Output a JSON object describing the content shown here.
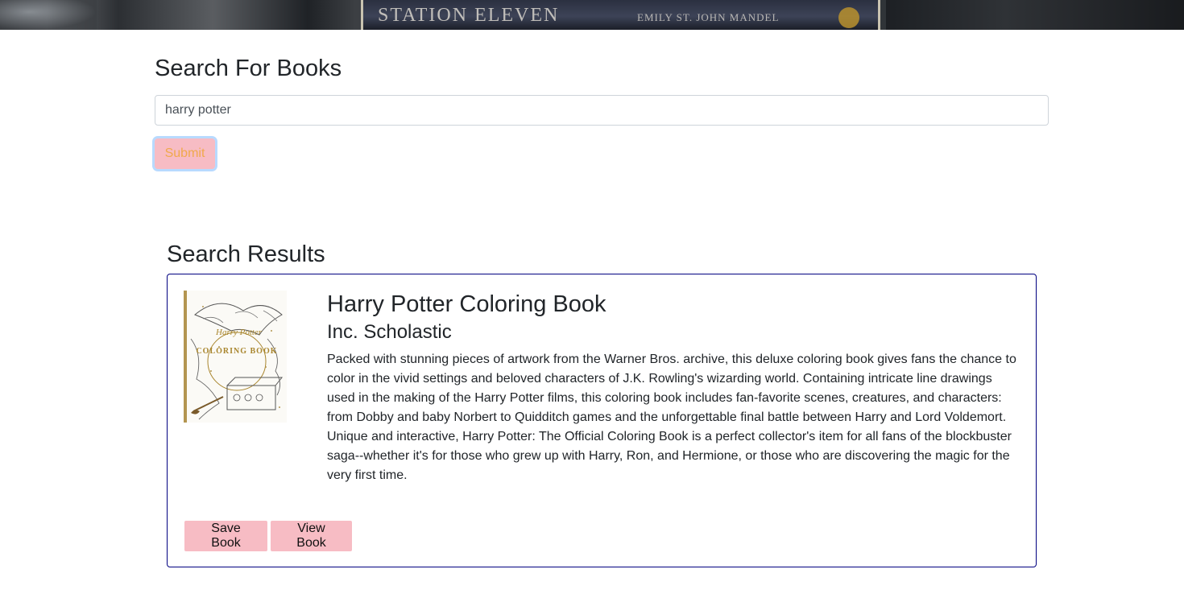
{
  "banner": {
    "book_title": "STATION ELEVEN",
    "book_author": "EMILY ST. JOHN MANDEL"
  },
  "search": {
    "heading": "Search For Books",
    "query": "harry potter",
    "submit_label": "Submit"
  },
  "results": {
    "heading": "Search Results",
    "items": [
      {
        "title": "Harry Potter Coloring Book",
        "author": "Inc. Scholastic",
        "description": "Packed with stunning pieces of artwork from the Warner Bros. archive, this deluxe coloring book gives fans the chance to color in the vivid settings and beloved characters of J.K. Rowling's wizarding world. Containing intricate line drawings used in the making of the Harry Potter films, this coloring book includes fan-favorite scenes, creatures, and characters: from Dobby and baby Norbert to Quidditch games and the unforgettable final battle between Harry and Lord Voldemort. Unique and interactive, Harry Potter: The Official Coloring Book is a perfect collector's item for all fans of the blockbuster saga--whether it's for those who grew up with Harry, Ron, and Hermione, or those who are discovering the magic for the very first time.",
        "cover": {
          "brand": "Harry Potter",
          "title": "COLORING BOOK"
        },
        "save_label": "Save Book",
        "view_label": "View Book"
      }
    ]
  },
  "colors": {
    "button_bg": "#f7bcc4",
    "submit_text": "#f0a94c",
    "card_border": "#000080"
  }
}
